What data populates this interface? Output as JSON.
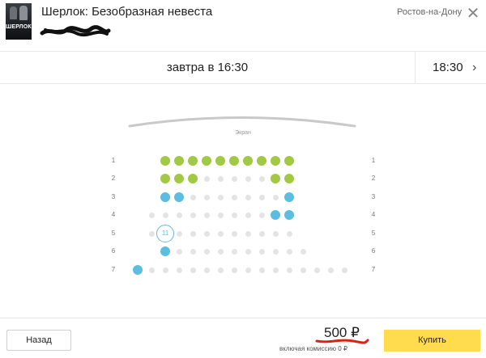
{
  "header": {
    "title": "Шерлок: Безобразная невеста",
    "poster_text": "ШЕРЛОК",
    "city": "Ростов-на-Дону",
    "close_symbol": "✕"
  },
  "session": {
    "current": "завтра в 16:30",
    "next_time": "18:30",
    "next_arrow": "›"
  },
  "hall": {
    "screen_label": "Экран",
    "selected_seat_number": "11",
    "rows": [
      {
        "label": "1",
        "seats": [
          "taken",
          "taken",
          "taken",
          "taken",
          "taken",
          "taken",
          "taken",
          "taken",
          "taken",
          "taken"
        ]
      },
      {
        "label": "2",
        "seats": [
          "taken",
          "taken",
          "taken",
          "free",
          "free",
          "free",
          "free",
          "free",
          "taken",
          "taken"
        ]
      },
      {
        "label": "3",
        "seats": [
          "taken-blue",
          "taken-blue",
          "free",
          "free",
          "free",
          "free",
          "free",
          "free",
          "free",
          "taken-blue"
        ]
      },
      {
        "label": "4",
        "seats": [
          "free",
          "free",
          "free",
          "free",
          "free",
          "free",
          "free",
          "free",
          "free",
          "taken-blue",
          "taken-blue"
        ]
      },
      {
        "label": "5",
        "seats": [
          "free",
          "selected",
          "free",
          "free",
          "free",
          "free",
          "free",
          "free",
          "free",
          "free",
          "free"
        ]
      },
      {
        "label": "6",
        "seats": [
          "taken-blue",
          "free",
          "free",
          "free",
          "free",
          "free",
          "free",
          "free",
          "free",
          "free",
          "free"
        ]
      },
      {
        "label": "7",
        "seats": [
          "taken-blue",
          "free",
          "free",
          "free",
          "free",
          "free",
          "free",
          "free",
          "free",
          "free",
          "free",
          "free",
          "free",
          "free",
          "free",
          "free"
        ]
      }
    ]
  },
  "colors": {
    "taken": "#a2c944",
    "taken_blue": "#5bbde0",
    "free": "#e4e4e4",
    "selected_ring": "#6ab8dc",
    "buy_button": "#ffdb4d",
    "scribble": "#111111",
    "price_underline": "#d8231a"
  },
  "footer": {
    "back_label": "Назад",
    "price": "500 ₽",
    "commission": "включая комиссию 0 ₽",
    "buy_label": "Купить"
  }
}
